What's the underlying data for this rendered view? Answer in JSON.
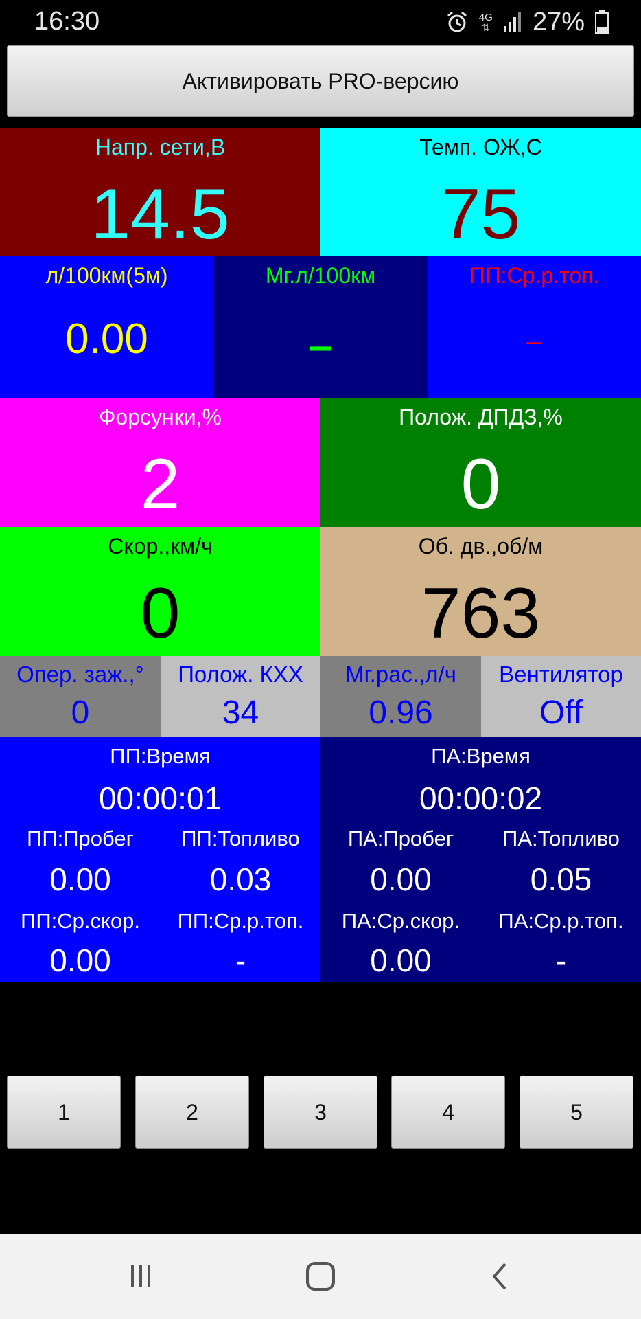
{
  "status": {
    "time": "16:30",
    "network": "4G",
    "battery": "27%"
  },
  "pro_button": "Активировать PRO-версию",
  "tiles": {
    "voltage": {
      "label": "Напр. сети,В",
      "value": "14.5",
      "bg": "#7c0000",
      "label_color": "#33ffff",
      "value_color": "#33ffff"
    },
    "coolant": {
      "label": "Темп. ОЖ,С",
      "value": "75",
      "bg": "#00ffff",
      "label_color": "#000000",
      "value_color": "#7c0000"
    },
    "fuel5m": {
      "label": "л/100км(5м)",
      "value": "0.00",
      "bg": "#0000ff",
      "label_color": "#ffff00",
      "value_color": "#ffff00"
    },
    "inst_fuel": {
      "label": "Мг.л/100км",
      "value": "–",
      "bg": "#00007f",
      "label_color": "#00ff00",
      "value_color": "#00ff00"
    },
    "trip_avg_fuel": {
      "label": "ПП:Ср.р.топ.",
      "value": "–",
      "bg": "#0000ff",
      "label_color": "#ff0000",
      "value_color": "#ff0000"
    },
    "injectors": {
      "label": "Форсунки,%",
      "value": "2",
      "bg": "#ff00ff",
      "label_color": "#ffffff",
      "value_color": "#ffffff"
    },
    "throttle": {
      "label": "Полож. ДПДЗ,%",
      "value": "0",
      "bg": "#008000",
      "label_color": "#ffffff",
      "value_color": "#ffffff"
    },
    "speed": {
      "label": "Скор.,км/ч",
      "value": "0",
      "bg": "#00ff00",
      "label_color": "#000000",
      "value_color": "#000000"
    },
    "rpm": {
      "label": "Об. дв.,об/м",
      "value": "763",
      "bg": "#d2b48c",
      "label_color": "#000000",
      "value_color": "#000000"
    },
    "ignition": {
      "label": "Опер. заж.,°",
      "value": "0",
      "bg": "#808080",
      "label_color": "#0000ff",
      "value_color": "#0000ff"
    },
    "idle_valve": {
      "label": "Полож. КХХ",
      "value": "34",
      "bg": "#c0c0c0",
      "label_color": "#0000ff",
      "value_color": "#0000ff"
    },
    "inst_flow": {
      "label": "Мг.рас.,л/ч",
      "value": "0.96",
      "bg": "#808080",
      "label_color": "#0000ff",
      "value_color": "#0000ff"
    },
    "fan": {
      "label": "Вентилятор",
      "value": "Off",
      "bg": "#c0c0c0",
      "label_color": "#0000ff",
      "value_color": "#0000ff"
    }
  },
  "trip_pp": {
    "bg": "#0000ff",
    "time_label": "ПП:Время",
    "time_value": "00:00:01",
    "distance_label": "ПП:Пробег",
    "distance_value": "0.00",
    "fuel_label": "ПП:Топливо",
    "fuel_value": "0.03",
    "avg_speed_label": "ПП:Ср.скор.",
    "avg_speed_value": "0.00",
    "avg_fuel_label": "ПП:Ср.р.топ.",
    "avg_fuel_value": "-"
  },
  "trip_pa": {
    "bg": "#00007f",
    "time_label": "ПА:Время",
    "time_value": "00:00:02",
    "distance_label": "ПА:Пробег",
    "distance_value": "0.00",
    "fuel_label": "ПА:Топливо",
    "fuel_value": "0.05",
    "avg_speed_label": "ПА:Ср.скор.",
    "avg_speed_value": "0.00",
    "avg_fuel_label": "ПА:Ср.р.топ.",
    "avg_fuel_value": "-"
  },
  "screen_buttons": [
    "1",
    "2",
    "3",
    "4",
    "5"
  ],
  "nav": {
    "recent_icon": "recent-apps-icon",
    "home_icon": "home-icon",
    "back_icon": "back-icon"
  }
}
